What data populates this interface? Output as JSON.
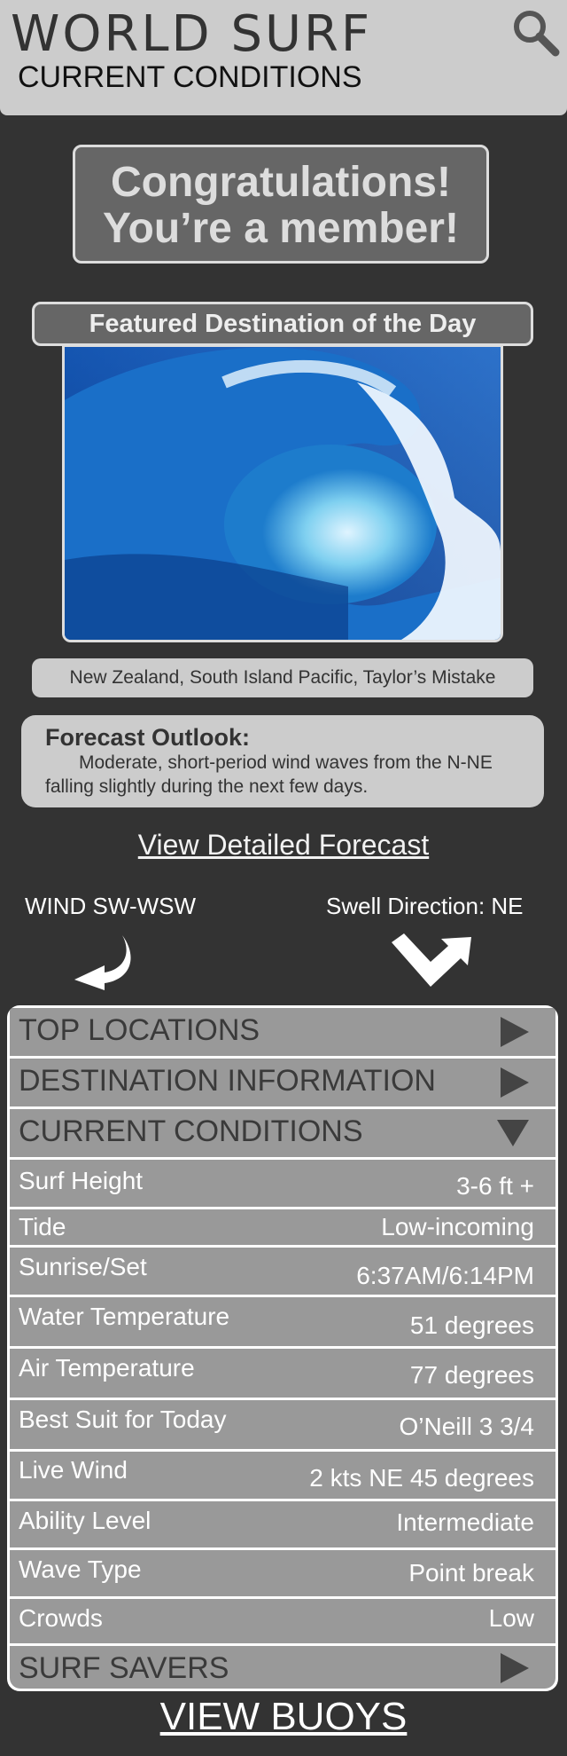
{
  "header": {
    "brand": "WORLD SURF",
    "subtitle": "CURRENT CONDITIONS",
    "search_icon": "search-icon"
  },
  "banner": {
    "line1": "Congratulations!",
    "line2": "You’re a member!"
  },
  "featured": {
    "title": "Featured Destination of the Day",
    "location": "New Zealand, South Island Pacific, Taylor’s Mistake"
  },
  "forecast": {
    "title": "Forecast Outlook:",
    "text": "Moderate, short-period wind waves from the N-NE falling slightly during the next few days."
  },
  "links": {
    "detailed_forecast": "View Detailed Forecast",
    "view_buoys": "VIEW BUOYS"
  },
  "indicators": {
    "wind": "WIND SW-WSW",
    "swell": "Swell Direction: NE"
  },
  "sections": {
    "top_locations": "TOP LOCATIONS",
    "destination_info": "DESTINATION INFORMATION",
    "current_conditions": "CURRENT CONDITIONS",
    "surf_savers": "SURF SAVERS"
  },
  "conditions": [
    {
      "label": "Surf Height",
      "value": "3-6 ft +"
    },
    {
      "label": "Tide",
      "value": "Low-incoming"
    },
    {
      "label": "Sunrise/Set",
      "value": "6:37AM/6:14PM"
    },
    {
      "label": "Water Temperature",
      "value": "51 degrees"
    },
    {
      "label": "Air Temperature",
      "value": "77 degrees"
    },
    {
      "label": "Best Suit for Today",
      "value": "O’Neill 3 3/4"
    },
    {
      "label": "Live Wind",
      "value": "2 kts NE 45 degrees"
    },
    {
      "label": "Ability Level",
      "value": "Intermediate"
    },
    {
      "label": "Wave Type",
      "value": "Point break"
    },
    {
      "label": "Crowds",
      "value": "Low"
    }
  ],
  "colors": {
    "background": "#333333",
    "header": "#cccccc",
    "panel_row": "#999999"
  }
}
